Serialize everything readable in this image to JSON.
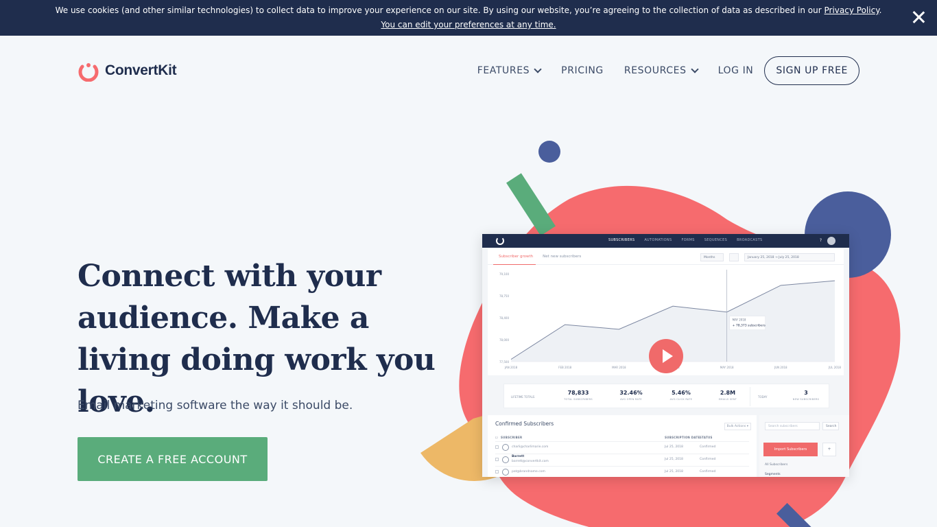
{
  "cookie_banner": {
    "text": "We use cookies (and other similar technologies) to collect data to improve your experience on our site. By using our website, you’re agreeing to the collection of data as described in our ",
    "privacy_link": "Privacy Policy",
    "period": ".",
    "preferences_link": "You can edit your preferences at any time.",
    "close_icon": "close-icon"
  },
  "header": {
    "logo_text": "ConvertKit",
    "nav": {
      "features": "FEATURES",
      "pricing": "PRICING",
      "resources": "RESOURCES",
      "login": "LOG IN",
      "signup": "SIGN UP FREE"
    }
  },
  "hero": {
    "title": "Connect with your audience. Make a living doing work you love.",
    "subtitle": "Email marketing software the way it should be.",
    "cta": "CREATE A FREE ACCOUNT"
  },
  "colors": {
    "navy": "#1f2d4d",
    "coral": "#f06a6a",
    "green": "#5aac7b",
    "blue": "#4a5e9c",
    "yellow": "#edb867"
  },
  "app_preview": {
    "nav_tabs": [
      "SUBSCRIBERS",
      "AUTOMATIONS",
      "FORMS",
      "SEQUENCES",
      "BROADCASTS"
    ],
    "active_tab": "SUBSCRIBERS",
    "help": "?",
    "chart_tabs": [
      "Subscriber growth",
      "Net new subscribers"
    ],
    "period_select": "Months",
    "date_range": "January 25, 2018 → July 25, 2018",
    "tooltip_date": "MAY 2018",
    "tooltip_value": "+ 78,373",
    "tooltip_unit": "subscribers",
    "totals_label": "LIFETIME TOTALS",
    "today_label": "TODAY",
    "stats": [
      {
        "value": "78,833",
        "label": "TOTAL SUBSCRIBERS"
      },
      {
        "value": "32.46%",
        "label": "AVG OPEN RATE"
      },
      {
        "value": "5.46%",
        "label": "AVG CLICK RATE"
      },
      {
        "value": "2.8M",
        "label": "EMAILS SENT"
      },
      {
        "value": "3",
        "label": "NEW SUBSCRIBERS"
      }
    ],
    "table_title": "Confirmed Subscribers",
    "bulk_actions": "Bulk Actions ▾",
    "columns": [
      "SUBSCRIBER",
      "SUBSCRIPTION DATE",
      "STATUS"
    ],
    "rows": [
      {
        "name": "",
        "email": "charli@charlimarie.com",
        "date": "Jul 25, 2018",
        "status": "Confirmed"
      },
      {
        "name": "Barrett",
        "email": "barrett@convertkit.com",
        "date": "Jul 25, 2018",
        "status": "Confirmed"
      },
      {
        "name": "",
        "email": "pat@brandname.com",
        "date": "Jul 25, 2018",
        "status": "Confirmed"
      }
    ],
    "search_placeholder": "Search subscribers",
    "search_button": "Search",
    "import_button": "Import Subscribers",
    "plus": "+",
    "all_subscribers": "All Subscribers",
    "segments": "Segments"
  },
  "chart_data": {
    "type": "area",
    "categories": [
      "JAN 2018",
      "FEB 2018",
      "MAR 2018",
      "APR 2018",
      "MAY 2018",
      "JUN 2018",
      "JUL 2018"
    ],
    "values": [
      77350,
      78100,
      78000,
      78500,
      78373,
      78950,
      79050
    ],
    "y_ticks": [
      "77,500",
      "78,000",
      "78,400",
      "78,750",
      "79,100"
    ],
    "ylim": [
      77300,
      79200
    ]
  }
}
